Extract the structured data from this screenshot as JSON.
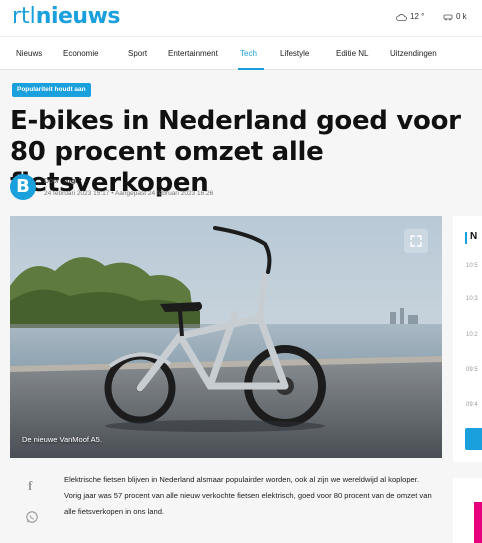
{
  "header": {
    "logo_prefix": "rtl",
    "logo_main": "nieuws",
    "weather": "12 °",
    "traffic": "0 k"
  },
  "nav": {
    "items": [
      "Nieuws",
      "Economie",
      "Sport",
      "Entertainment",
      "Tech",
      "Lifestyle",
      "Editie NL",
      "Uitzendingen"
    ],
    "active": "Tech"
  },
  "article": {
    "badge": "Populariteit houdt aan",
    "title": "E-bikes in Nederland goed voor 80 procent omzet alle fietsverkopen",
    "author_initial": "B",
    "byline_prefix": "Door ",
    "author": "Bright",
    "date_line": "24 februari 2023 15:17  •  Aangepast 24 februari 2023 16:26",
    "image_caption": "De nieuwe VanMoof A5.",
    "body": "Elektrische fietsen blijven in Nederland alsmaar populairder worden, ook al zijn we wereldwijd al koploper. Vorig jaar was 57 procent van alle nieuw verkochte fietsen elektrisch, goed voor 80 procent van de omzet van alle fietsverkopen in ons land."
  },
  "sidebar": {
    "heading_initial": "N",
    "times": [
      "10:5",
      "10:3",
      "10:2",
      "09:5",
      "09:4"
    ]
  },
  "colors": {
    "brand": "#1aa0dc",
    "accent_pink": "#e6007e"
  },
  "icons": {
    "facebook": "facebook-icon",
    "whatsapp": "whatsapp-icon",
    "expand": "expand-icon",
    "weather": "cloud-icon",
    "traffic": "traffic-icon"
  }
}
